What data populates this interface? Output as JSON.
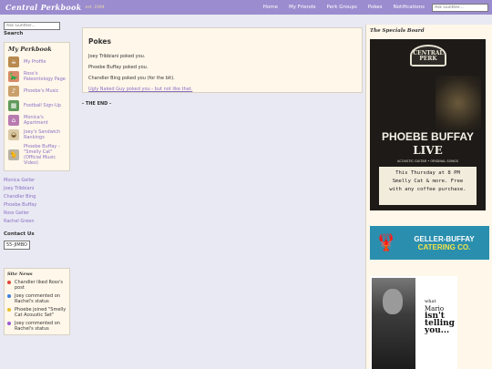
{
  "topbar": {
    "brand": "Central Perkbook",
    "est": "est. 1994",
    "nav": [
      "Home",
      "My Friends",
      "Perk Groups",
      "Pokes",
      "Notifications"
    ],
    "search_placeholder": "Ask Gunther..."
  },
  "left": {
    "search_placeholder": "Ask Gunther...",
    "search_label": "Search",
    "perkbook_title": "My Perkbook",
    "perkbook_items": [
      {
        "label": "My Profile",
        "icon": "coffee-cup-icon"
      },
      {
        "label": "Ross's Paleontology Page",
        "icon": "dinosaur-icon"
      },
      {
        "label": "Phoebe's Music",
        "icon": "guitar-icon"
      },
      {
        "label": "Football Sign-Up",
        "icon": "football-icon"
      },
      {
        "label": "Monica's Apartment",
        "icon": "apartment-icon"
      },
      {
        "label": "Joey's Sandwich Rankings",
        "icon": "sandwich-icon"
      },
      {
        "label": "Phoebe Buffay - \"Smelly Cat\" (Official Music Video)",
        "icon": "cat-icon"
      }
    ],
    "friends": [
      "Monica Geller",
      "Joey Tribbiani",
      "Chandler Bing",
      "Phoebe Buffay",
      "Ross Geller",
      "Rachel Green"
    ],
    "contact_heading": "Contact Us",
    "contact_button": "55-JIMBO",
    "site_news_title": "Site News",
    "site_news": [
      {
        "text": "Chandler liked Ross's post",
        "color": "#e0463c"
      },
      {
        "text": "Joey commented on Rachel's status",
        "color": "#3c7ee0"
      },
      {
        "text": "Phoebe joined \"Smelly Cat Acoustic Set\"",
        "color": "#e6c02a"
      },
      {
        "text": "Joey commented on Rachel's status",
        "color": "#9a5ad6"
      }
    ]
  },
  "main": {
    "title": "Pokes",
    "pokes": [
      "Joey Tribbiani poked you.",
      "Phoebe Buffay poked you.",
      "Chandler Bing poked you (for the bit)."
    ],
    "poke_link": "Ugly Naked Guy poked you - but not like that.",
    "end_text": "- THE END -"
  },
  "right": {
    "title": "The Specials Board",
    "poster": {
      "sign_line1": "CENTRAL",
      "sign_line2": "PERK",
      "name": "PHOEBE BUFFAY",
      "live": "LIVE",
      "subtitle": "ACOUSTIC GUITAR • ORIGINAL SONGS",
      "card_lines": [
        "This Thursday at 8 PM",
        "Smelly Cat & more. Free",
        "with any coffee purchase."
      ]
    },
    "catering": {
      "line1": "GELLER-BUFFAY",
      "line2": "CATERING CO."
    },
    "mario": {
      "line1": "what",
      "line2": "Mario",
      "line3": "isn't",
      "line4": "telling",
      "line5": "you..."
    }
  }
}
